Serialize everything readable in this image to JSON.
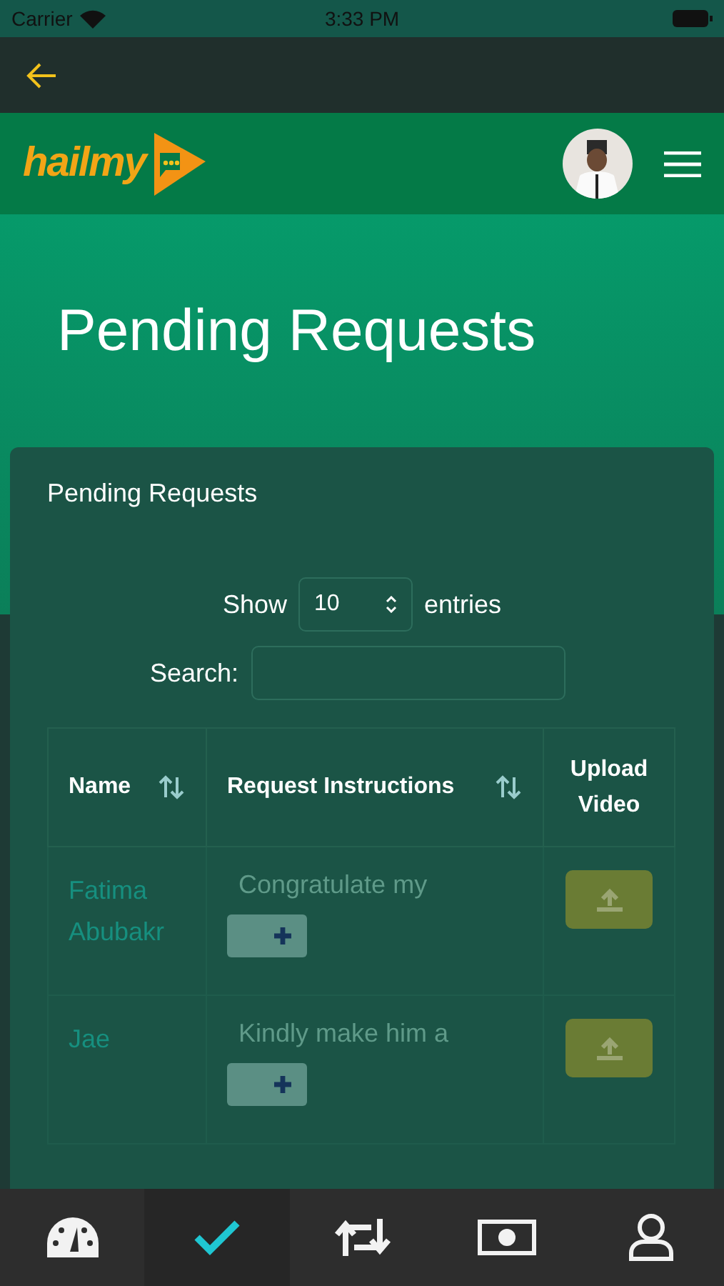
{
  "status_bar": {
    "carrier": "Carrier",
    "time": "3:33 PM"
  },
  "header": {
    "logo_text": "hailmy"
  },
  "hero": {
    "title": "Pending Requests"
  },
  "card": {
    "title": "Pending Requests",
    "show_label": "Show",
    "entries_value": "10",
    "entries_label": "entries",
    "search_label": "Search:"
  },
  "table": {
    "columns": [
      {
        "label": "Name",
        "sortable": true
      },
      {
        "label": "Request Instructions",
        "sortable": true
      },
      {
        "label": "Upload Video",
        "sortable": false
      }
    ],
    "rows": [
      {
        "name": "Fatima Abubakr",
        "instructions": "Congratulate my"
      },
      {
        "name": "Jae",
        "instructions": "Kindly make him a"
      }
    ]
  },
  "tab_bar": [
    {
      "kind": "dashboard",
      "selected": false
    },
    {
      "kind": "check",
      "selected": true
    },
    {
      "kind": "repeat",
      "selected": false
    },
    {
      "kind": "money",
      "selected": false
    },
    {
      "kind": "user",
      "selected": false
    }
  ]
}
